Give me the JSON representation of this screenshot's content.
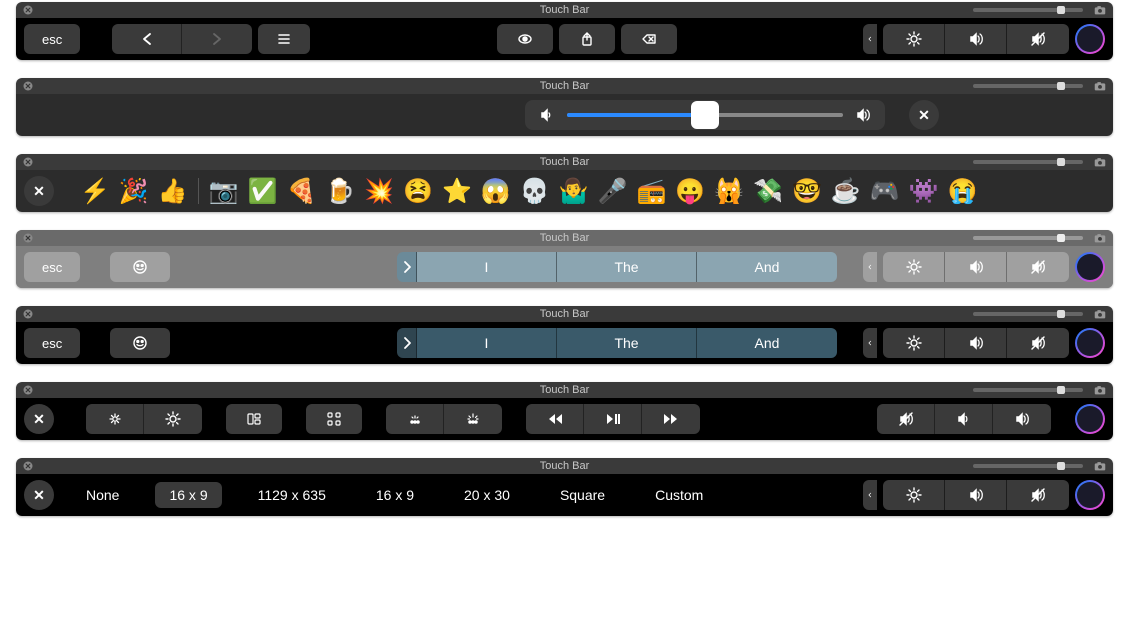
{
  "header": {
    "title": "Touch Bar"
  },
  "esc_label": "esc",
  "bar1": {
    "nav_group": [
      "back",
      "forward",
      "list"
    ],
    "center_group": [
      "preview",
      "share",
      "delete"
    ]
  },
  "bar2": {
    "slider_fill_pct": 50
  },
  "bar3": {
    "favorites": [
      "⚡️",
      "🎉",
      "👍"
    ],
    "recent": [
      "📷",
      "✅",
      "🍕",
      "🍺",
      "💥",
      "😫",
      "⭐",
      "😱",
      "💀",
      "🤷‍♂️",
      "🎤",
      "📻",
      "😛",
      "🙀",
      "💸",
      "🤓",
      "☕",
      "🎮",
      "👾",
      "😭"
    ]
  },
  "predictive": {
    "suggestions": [
      "I",
      "The",
      "And"
    ]
  },
  "bar6": {
    "items": [
      "brightness-down",
      "brightness-up",
      "mission-control",
      "launchpad",
      "keyboard-brightness-down",
      "keyboard-brightness-up"
    ],
    "media": [
      "rewind",
      "play-pause",
      "fast-forward"
    ],
    "volume": [
      "mute",
      "volume-down",
      "volume-up"
    ]
  },
  "bar7": {
    "options": [
      {
        "label": "None",
        "active": false
      },
      {
        "label": "16 x 9",
        "active": true
      },
      {
        "label": "1129 x 635",
        "active": false
      },
      {
        "label": "16 x 9",
        "active": false
      },
      {
        "label": "20 x 30",
        "active": false
      },
      {
        "label": "Square",
        "active": false
      },
      {
        "label": "Custom",
        "active": false
      }
    ]
  },
  "ctrl_strip": [
    "brightness",
    "volume",
    "mute",
    "siri"
  ]
}
